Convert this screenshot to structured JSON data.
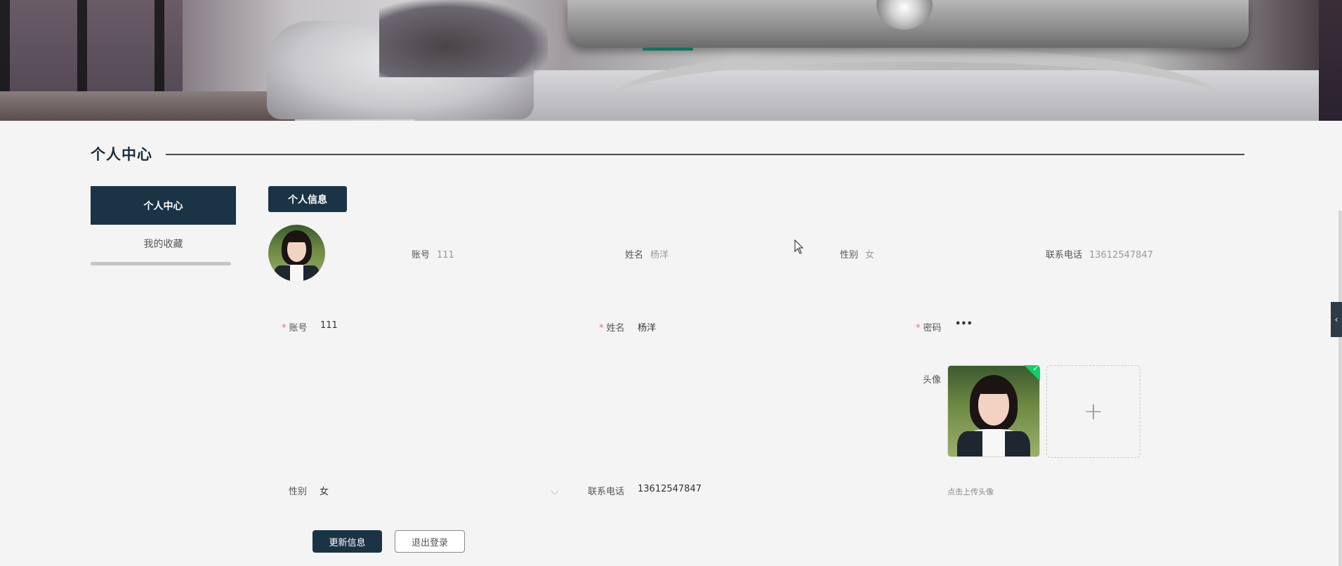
{
  "section": {
    "title": "个人中心"
  },
  "sidebar": {
    "items": [
      {
        "label": "个人中心",
        "active": true
      },
      {
        "label": "我的收藏",
        "active": false
      }
    ]
  },
  "tab": {
    "label": "个人信息"
  },
  "info": {
    "account_label": "账号",
    "account_value": "111",
    "name_label": "姓名",
    "name_value": "杨洋",
    "gender_label": "性别",
    "gender_value": "女",
    "phone_label": "联系电话",
    "phone_value": "13612547847"
  },
  "form": {
    "account": {
      "label": "账号",
      "value": "111",
      "required": "*"
    },
    "name": {
      "label": "姓名",
      "value": "杨洋",
      "required": "*"
    },
    "password": {
      "label": "密码",
      "value": "•••",
      "required": "*"
    },
    "avatar": {
      "label": "头像",
      "tip": "点击上传头像",
      "add_icon": "+"
    },
    "gender": {
      "label": "性别",
      "value": "女"
    },
    "phone": {
      "label": "联系电话",
      "value": "13612547847"
    }
  },
  "buttons": {
    "update": "更新信息",
    "logout": "退出登录"
  },
  "colors": {
    "primary": "#1a3446",
    "required": "#f56c6c",
    "success": "#13ce66",
    "accent": "#17705f"
  },
  "icons": {
    "collapse": "chevron-left-icon",
    "upload_success": "check-icon",
    "add": "plus-icon"
  }
}
